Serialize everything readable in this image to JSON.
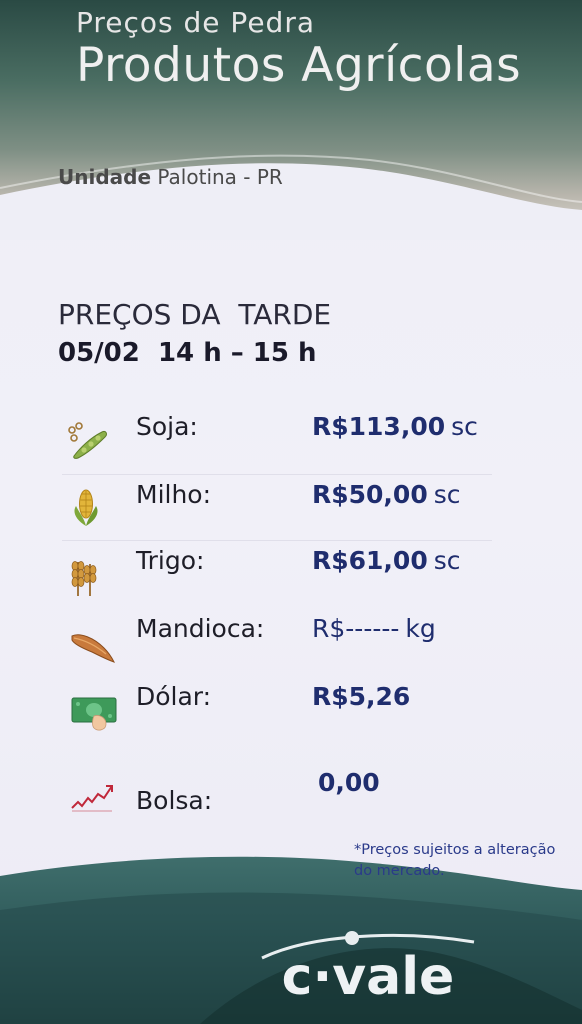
{
  "header": {
    "supra_title": "Preços de Pedra",
    "title": "Produtos Agrícolas",
    "unit_prefix": "Unidade",
    "unit_name": "Palotina - PR"
  },
  "period": {
    "title": "PREÇOS DA  TARDE",
    "date_time": "05/02  14 h – 15 h"
  },
  "rows": [
    {
      "icon": "soy-icon",
      "label": "Soja:",
      "price": "R$113,00",
      "unit": "sc"
    },
    {
      "icon": "corn-icon",
      "label": "Milho:",
      "price": "R$50,00",
      "unit": "sc"
    },
    {
      "icon": "wheat-icon",
      "label": "Trigo:",
      "price": "R$61,00",
      "unit": "sc"
    },
    {
      "icon": "cassava-icon",
      "label": "Mandioca:",
      "price": "R$------",
      "unit": "kg"
    },
    {
      "icon": "money-icon",
      "label": "Dólar:",
      "price": "R$5,26",
      "unit": ""
    },
    {
      "icon": "chart-up-icon",
      "label": "Bolsa:",
      "price": "0,00",
      "unit": ""
    }
  ],
  "note": "*Preços sujeitos a alteração do mercado.",
  "brand": {
    "logo_text": "c·vale"
  },
  "colors": {
    "price": "#1f2d6e",
    "header_dark": "#2a4a44",
    "footer": "#2f5a5c"
  }
}
